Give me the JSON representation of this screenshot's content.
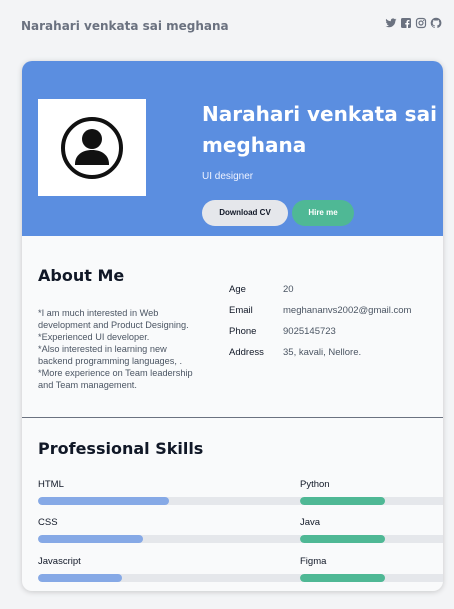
{
  "header": {
    "site_name": "Narahari venkata sai meghana",
    "social_icons": [
      "twitter-icon",
      "facebook-icon",
      "instagram-icon",
      "github-icon"
    ]
  },
  "hero": {
    "name": "Narahari venkata sai meghana",
    "role": "UI designer",
    "download_label": "Download CV",
    "hire_label": "Hire me"
  },
  "about": {
    "title": "About Me",
    "lines": [
      "*I am much interested in Web",
      "development and Product Designing.",
      "*Experienced UI developer.",
      "*Also interested in learning new",
      "backend programming languages, .",
      "*More experience on Team leadership",
      "and Team management."
    ],
    "info": [
      {
        "label": "Age",
        "value": "20"
      },
      {
        "label": "Email",
        "value": "meghananvs2002@gmail.com"
      },
      {
        "label": "Phone",
        "value": "9025145723"
      },
      {
        "label": "Address",
        "value": "35, kavali, Nellore."
      }
    ]
  },
  "skills": {
    "title": "Professional Skills",
    "items": [
      {
        "name": "HTML",
        "level": 0.5
      },
      {
        "name": "Python",
        "level": 0.53
      },
      {
        "name": "CSS",
        "level": 0.4
      },
      {
        "name": "Java",
        "level": 0.53
      },
      {
        "name": "Javascript",
        "level": 0.32
      },
      {
        "name": "Figma",
        "level": 0.53
      }
    ]
  },
  "colors": {
    "hero": "#5b8ee0",
    "accent": "#4fb895",
    "bar_blue": "#86a9e6",
    "bar_green": "#4fb895"
  }
}
